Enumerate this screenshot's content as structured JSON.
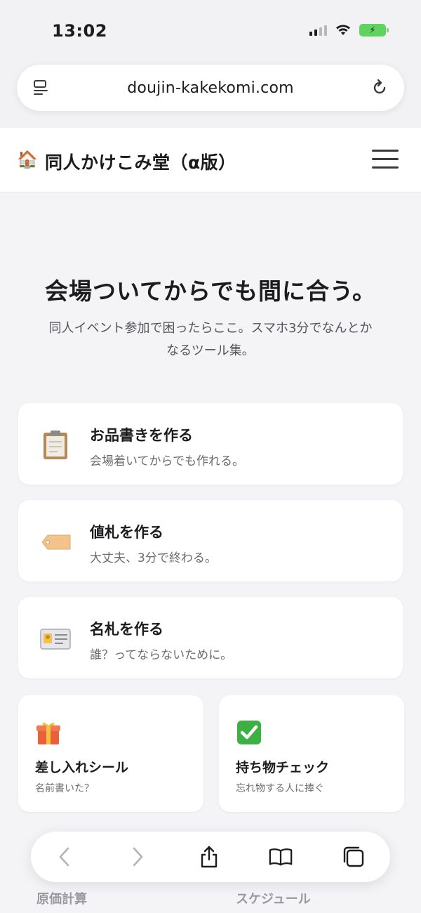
{
  "status_bar": {
    "time": "13:02"
  },
  "browser": {
    "url": "doujin-kakekomi.com"
  },
  "site": {
    "logo_emoji": "🏠",
    "title": "同人かけこみ堂（α版）"
  },
  "hero": {
    "title": "会場ついてからでも間に合う。",
    "subtitle_line1": "同人イベント参加で困ったらここ。スマホ3分でなんとか",
    "subtitle_line2": "なるツール集。"
  },
  "tools": [
    {
      "title": "お品書きを作る",
      "desc": "会場着いてからでも作れる。",
      "icon": "clipboard-icon"
    },
    {
      "title": "値札を作る",
      "desc": "大丈夫、3分で終わる。",
      "icon": "price-tag-icon"
    },
    {
      "title": "名札を作る",
      "desc": "誰？ってならないために。",
      "icon": "id-card-icon"
    }
  ],
  "small_tools": [
    {
      "title": "差し入れシール",
      "desc": "名前書いた？",
      "icon": "gift-icon"
    },
    {
      "title": "持ち物チェック",
      "desc": "忘れ物する人に捧ぐ",
      "icon": "check-mark-icon"
    }
  ],
  "peek": [
    "原価計算",
    "スケジュール"
  ],
  "colors": {
    "background": "#f4f4f7",
    "card": "#ffffff",
    "battery": "#5ed35e",
    "check": "#3cb043"
  }
}
